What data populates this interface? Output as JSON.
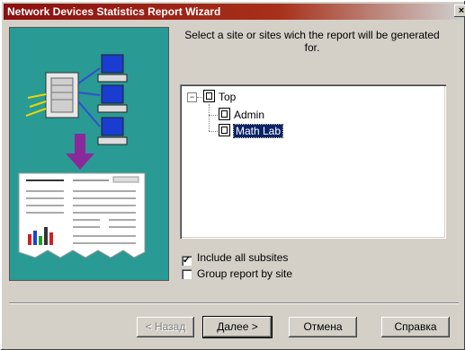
{
  "window": {
    "title": "Network Devices Statistics Report Wizard",
    "close_glyph": "×"
  },
  "heading": "Select a site or sites wich the report will be generated for.",
  "tree": {
    "root": {
      "label": "Top",
      "expander": "−"
    },
    "children": [
      {
        "label": "Admin",
        "selected": false
      },
      {
        "label": "Math Lab",
        "selected": true
      }
    ]
  },
  "options": {
    "include_subsites": {
      "label": "Include all subsites",
      "checked": true,
      "mark": "✓"
    },
    "group_by_site": {
      "label": "Group report by site",
      "checked": false,
      "mark": ""
    }
  },
  "buttons": {
    "back": "< Назад",
    "next": "Далее >",
    "cancel": "Отмена",
    "help": "Справка"
  },
  "colors": {
    "panel": "#2a9a94",
    "arrow": "#8a2a9a",
    "title_start": "#8a1010",
    "selection": "#0a246a"
  }
}
